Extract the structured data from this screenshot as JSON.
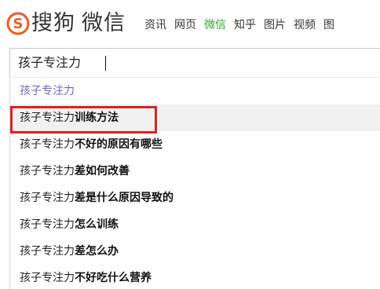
{
  "logo": {
    "brand": "搜狗",
    "product": "微信",
    "accent_color": "#f15a22"
  },
  "nav": {
    "items": [
      {
        "label": "资讯",
        "active": false
      },
      {
        "label": "网页",
        "active": false
      },
      {
        "label": "微信",
        "active": true
      },
      {
        "label": "知乎",
        "active": false
      },
      {
        "label": "图片",
        "active": false
      },
      {
        "label": "视频",
        "active": false
      },
      {
        "label": "图",
        "active": false
      }
    ],
    "active_color": "#2eaa2e"
  },
  "search": {
    "value": "孩子专注力"
  },
  "suggestions": [
    {
      "prefix": "孩子专注力",
      "suffix": ""
    },
    {
      "prefix": "孩子专注力",
      "suffix": "训练方法"
    },
    {
      "prefix": "孩子专注力",
      "suffix": "不好的原因有哪些"
    },
    {
      "prefix": "孩子专注力",
      "suffix": "差如何改善"
    },
    {
      "prefix": "孩子专注力",
      "suffix": "差是什么原因导致的"
    },
    {
      "prefix": "孩子专注力",
      "suffix": "怎么训练"
    },
    {
      "prefix": "孩子专注力",
      "suffix": "差怎么办"
    },
    {
      "prefix": "孩子专注力",
      "suffix": "不好吃什么营养"
    }
  ],
  "highlight": {
    "color": "#e0201d"
  }
}
